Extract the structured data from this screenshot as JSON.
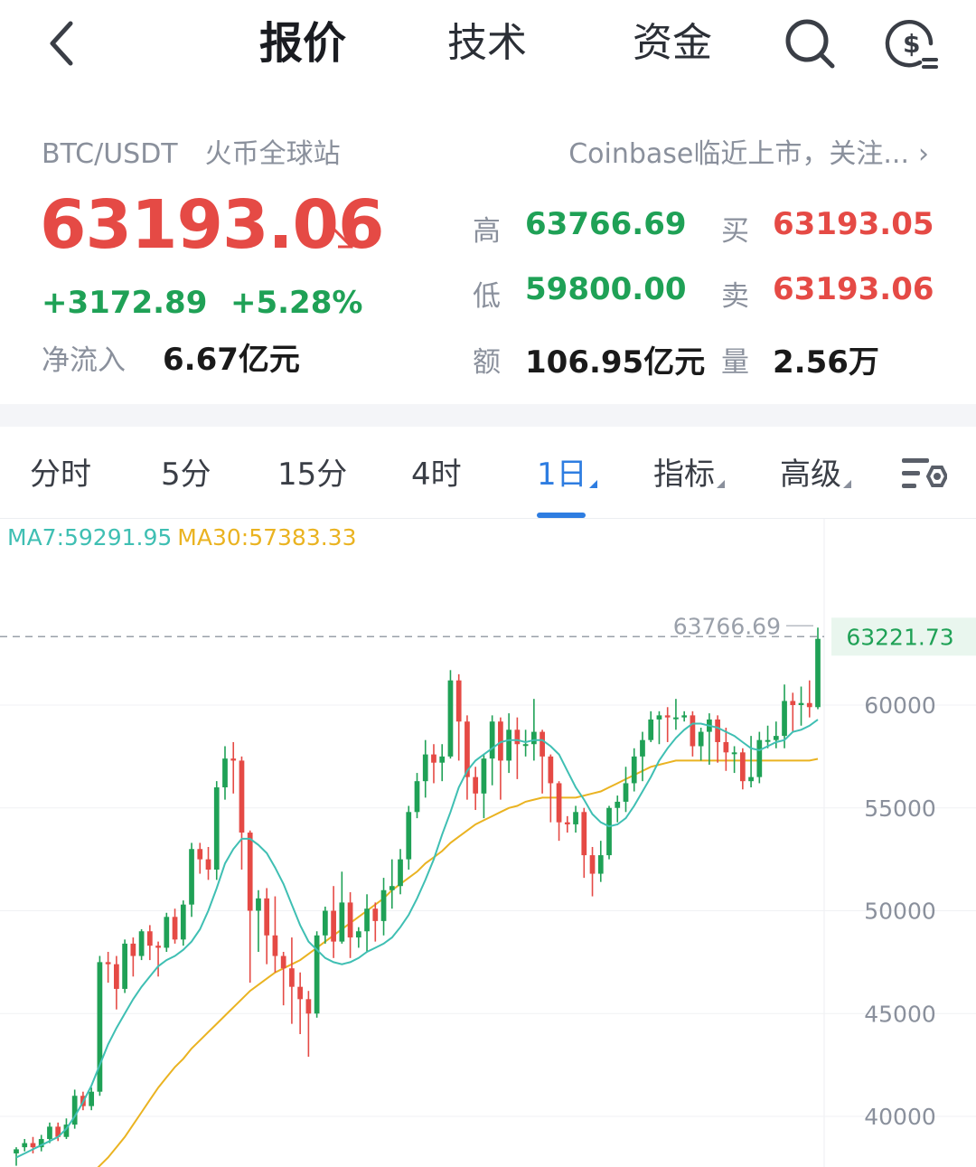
{
  "nav": {
    "tabs": [
      {
        "label": "报价",
        "active": true
      },
      {
        "label": "技术",
        "active": false
      },
      {
        "label": "资金",
        "active": false
      }
    ]
  },
  "summary": {
    "pair": "BTC/USDT",
    "exchange": "火币全球站",
    "news": "Coinbase临近上市，关注...",
    "last_price": "63193.06",
    "change": "+3172.89",
    "change_pct": "+5.28%",
    "inflow_label": "净流入",
    "inflow_value": "6.67亿元",
    "stats": {
      "high_label": "高",
      "high": "63766.69",
      "low_label": "低",
      "low": "59800.00",
      "amount_label": "额",
      "amount": "106.95亿元",
      "bid_label": "买",
      "bid": "63193.05",
      "ask_label": "卖",
      "ask": "63193.06",
      "volume_label": "量",
      "volume": "2.56万"
    }
  },
  "periods": [
    {
      "label": "分时"
    },
    {
      "label": "5分"
    },
    {
      "label": "15分"
    },
    {
      "label": "4时"
    },
    {
      "label": "1日",
      "active": true
    },
    {
      "label": "指标"
    },
    {
      "label": "高级"
    }
  ],
  "colors": {
    "up": "#1fa156",
    "down": "#e54a45",
    "accent": "#2e7de1",
    "ma7": "#3fbfb3",
    "ma30": "#eab321"
  },
  "chart_data": {
    "type": "candlestick",
    "ma7_label": "MA7:59291.95",
    "ma30_label": "MA30:57383.33",
    "max_label": "63766.69",
    "current_label": "63221.73",
    "y_ticks": [
      "60000",
      "55000",
      "50000",
      "45000",
      "40000"
    ],
    "y_tick_values": [
      60000,
      55000,
      50000,
      45000,
      40000
    ],
    "ylim": [
      38500,
      66500
    ],
    "max_value": 63766.69,
    "current_value": 63221.73,
    "candles": [
      [
        38200,
        38400,
        37600,
        38500
      ],
      [
        38500,
        38700,
        38300,
        38900
      ],
      [
        38700,
        38500,
        38200,
        39000
      ],
      [
        38500,
        38900,
        38300,
        39100
      ],
      [
        38900,
        39500,
        38700,
        39700
      ],
      [
        39500,
        39000,
        38800,
        39700
      ],
      [
        39000,
        39600,
        38900,
        39900
      ],
      [
        39600,
        41000,
        39400,
        41300
      ],
      [
        41000,
        40500,
        40300,
        41200
      ],
      [
        40500,
        41200,
        40300,
        41400
      ],
      [
        41200,
        47500,
        41000,
        47800
      ],
      [
        47500,
        47400,
        46500,
        48000
      ],
      [
        47400,
        46200,
        45200,
        47800
      ],
      [
        46200,
        48400,
        46000,
        48600
      ],
      [
        48400,
        47800,
        46800,
        48700
      ],
      [
        47800,
        49000,
        47600,
        49100
      ],
      [
        49000,
        48300,
        47600,
        49300
      ],
      [
        48300,
        48200,
        46800,
        48500
      ],
      [
        48200,
        49700,
        48000,
        49900
      ],
      [
        49700,
        48600,
        48400,
        50100
      ],
      [
        48600,
        50300,
        48300,
        50500
      ],
      [
        50300,
        53000,
        49700,
        53300
      ],
      [
        53000,
        52500,
        51800,
        53300
      ],
      [
        52500,
        52000,
        51500,
        53100
      ],
      [
        52000,
        56000,
        51500,
        56300
      ],
      [
        56000,
        57400,
        55400,
        58000
      ],
      [
        57400,
        57300,
        55700,
        58200
      ],
      [
        57300,
        53800,
        52000,
        57500
      ],
      [
        53800,
        50000,
        46500,
        53900
      ],
      [
        50000,
        50600,
        48000,
        51000
      ],
      [
        50600,
        48800,
        47400,
        51100
      ],
      [
        48800,
        47800,
        47000,
        50700
      ],
      [
        47800,
        47200,
        45400,
        48000
      ],
      [
        47200,
        46300,
        44500,
        48700
      ],
      [
        46300,
        45700,
        44000,
        47000
      ],
      [
        45700,
        45000,
        42900,
        46100
      ],
      [
        45000,
        48800,
        44800,
        49000
      ],
      [
        48800,
        50000,
        48400,
        50200
      ],
      [
        50000,
        48500,
        47700,
        51200
      ],
      [
        48500,
        50400,
        48400,
        51900
      ],
      [
        50400,
        48700,
        47700,
        50900
      ],
      [
        48700,
        49000,
        48200,
        49200
      ],
      [
        49000,
        50100,
        48000,
        50800
      ],
      [
        50100,
        49500,
        48500,
        50400
      ],
      [
        49500,
        51000,
        48800,
        51600
      ],
      [
        51000,
        51200,
        50100,
        52500
      ],
      [
        51200,
        52500,
        50800,
        53000
      ],
      [
        52500,
        54800,
        52000,
        55100
      ],
      [
        54800,
        56300,
        54500,
        56700
      ],
      [
        56300,
        57600,
        55500,
        58300
      ],
      [
        57600,
        57200,
        56200,
        58100
      ],
      [
        57200,
        57500,
        56300,
        58100
      ],
      [
        57500,
        61200,
        57400,
        61700
      ],
      [
        61200,
        59200,
        57300,
        61500
      ],
      [
        59200,
        56500,
        55400,
        59500
      ],
      [
        56500,
        55700,
        54900,
        57000
      ],
      [
        55700,
        57400,
        54500,
        57600
      ],
      [
        57400,
        59200,
        56100,
        59500
      ],
      [
        59200,
        57300,
        55400,
        59400
      ],
      [
        57300,
        58800,
        56700,
        59600
      ],
      [
        58800,
        58100,
        56400,
        59400
      ],
      [
        58100,
        58100,
        57500,
        58800
      ],
      [
        58100,
        58700,
        57300,
        60300
      ],
      [
        58700,
        57500,
        55700,
        58800
      ],
      [
        57500,
        56200,
        54300,
        57600
      ],
      [
        56200,
        54300,
        53400,
        56300
      ],
      [
        54300,
        54200,
        53800,
        54600
      ],
      [
        54200,
        54800,
        53800,
        55100
      ],
      [
        54800,
        52700,
        51600,
        55000
      ],
      [
        52700,
        51800,
        50700,
        53100
      ],
      [
        51800,
        52700,
        51400,
        53400
      ],
      [
        52700,
        55000,
        52500,
        55100
      ],
      [
        55000,
        55300,
        54300,
        55600
      ],
      [
        55300,
        56200,
        54800,
        57000
      ],
      [
        56200,
        57500,
        55800,
        57900
      ],
      [
        57500,
        58300,
        56300,
        58700
      ],
      [
        58300,
        59300,
        58200,
        59700
      ],
      [
        59300,
        59500,
        58100,
        59700
      ],
      [
        59500,
        59400,
        58200,
        59900
      ],
      [
        59400,
        59400,
        58800,
        60300
      ],
      [
        59400,
        59500,
        59200,
        59700
      ],
      [
        59500,
        58000,
        57500,
        59700
      ],
      [
        58000,
        58700,
        57300,
        58900
      ],
      [
        58700,
        59300,
        57100,
        59600
      ],
      [
        59300,
        58200,
        57200,
        59500
      ],
      [
        58200,
        57700,
        56800,
        58900
      ],
      [
        57700,
        57700,
        56700,
        58000
      ],
      [
        57700,
        56300,
        55900,
        57900
      ],
      [
        56300,
        56500,
        56000,
        58500
      ],
      [
        56500,
        58300,
        56200,
        58700
      ],
      [
        58300,
        58300,
        57900,
        59000
      ],
      [
        58300,
        58500,
        57900,
        59200
      ],
      [
        58500,
        60200,
        57900,
        61000
      ],
      [
        60200,
        60000,
        58700,
        60600
      ],
      [
        60000,
        60100,
        59000,
        60900
      ],
      [
        60100,
        59900,
        59400,
        61200
      ],
      [
        59900,
        63222,
        59800,
        63767
      ]
    ],
    "ma7": [
      38000,
      38200,
      38400,
      38600,
      38800,
      39000,
      39400,
      40000,
      40700,
      41500,
      42500,
      43500,
      44300,
      45000,
      45700,
      46300,
      46800,
      47300,
      47600,
      47800,
      48100,
      48500,
      49100,
      50000,
      51100,
      52300,
      53000,
      53500,
      53500,
      53200,
      52800,
      52100,
      51300,
      50300,
      49300,
      48500,
      48100,
      47700,
      47500,
      47400,
      47500,
      47700,
      48000,
      48200,
      48400,
      48700,
      49200,
      49800,
      50600,
      51500,
      52500,
      53700,
      54800,
      56000,
      56800,
      57300,
      57600,
      57900,
      58200,
      58300,
      58300,
      58200,
      58300,
      58300,
      58000,
      57600,
      56800,
      56000,
      55400,
      54700,
      54300,
      54100,
      54200,
      54500,
      55100,
      55800,
      56500,
      57300,
      57900,
      58400,
      58800,
      59100,
      59100,
      59000,
      58900,
      58700,
      58500,
      58200,
      57900,
      57800,
      58000,
      58200,
      58300,
      58700,
      58800,
      59000,
      59292
    ],
    "ma30": [
      35000,
      35200,
      35400,
      35600,
      35800,
      36000,
      36300,
      36600,
      36900,
      37200,
      37600,
      38000,
      38500,
      39000,
      39600,
      40200,
      40800,
      41400,
      41900,
      42400,
      42800,
      43300,
      43700,
      44100,
      44500,
      44900,
      45300,
      45700,
      46100,
      46400,
      46700,
      47000,
      47200,
      47400,
      47600,
      47900,
      48200,
      48500,
      48800,
      49100,
      49400,
      49700,
      50000,
      50300,
      50600,
      51000,
      51300,
      51600,
      51900,
      52300,
      52600,
      52900,
      53300,
      53600,
      53900,
      54200,
      54400,
      54600,
      54800,
      55000,
      55100,
      55300,
      55400,
      55500,
      55500,
      55500,
      55500,
      55500,
      55600,
      55700,
      55800,
      56000,
      56200,
      56400,
      56600,
      56800,
      57000,
      57100,
      57200,
      57300,
      57300,
      57300,
      57300,
      57300,
      57300,
      57300,
      57300,
      57300,
      57300,
      57300,
      57300,
      57300,
      57300,
      57300,
      57300,
      57300,
      57383
    ]
  }
}
